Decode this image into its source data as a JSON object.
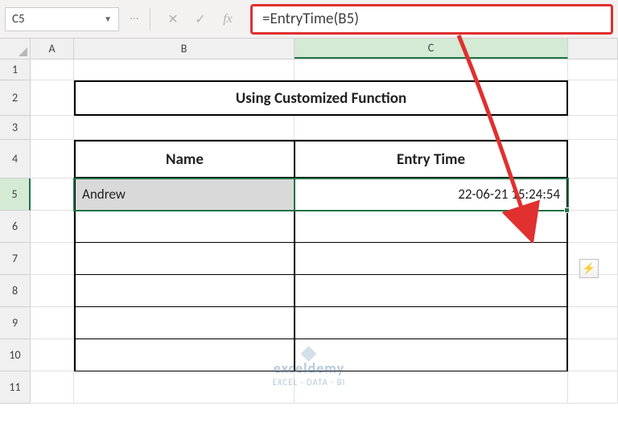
{
  "name_box": "C5",
  "formula_bar": {
    "cancel": "✕",
    "enter": "✓",
    "fx": "fx",
    "formula": "=EntryTime(B5)"
  },
  "columns": {
    "a": "A",
    "b": "B",
    "c": "C",
    "d": ""
  },
  "rows": [
    "1",
    "2",
    "3",
    "4",
    "5",
    "6",
    "7",
    "8",
    "9",
    "10",
    "11"
  ],
  "title": "Using Customized Function",
  "headers": {
    "name": "Name",
    "entry_time": "Entry Time"
  },
  "data": {
    "row5": {
      "name": "Andrew",
      "time": "22-06-21 15:24:54"
    }
  },
  "smart_tag": "⚡",
  "watermark": {
    "main": "exceldemy",
    "sub": "EXCEL · DATA · BI"
  }
}
